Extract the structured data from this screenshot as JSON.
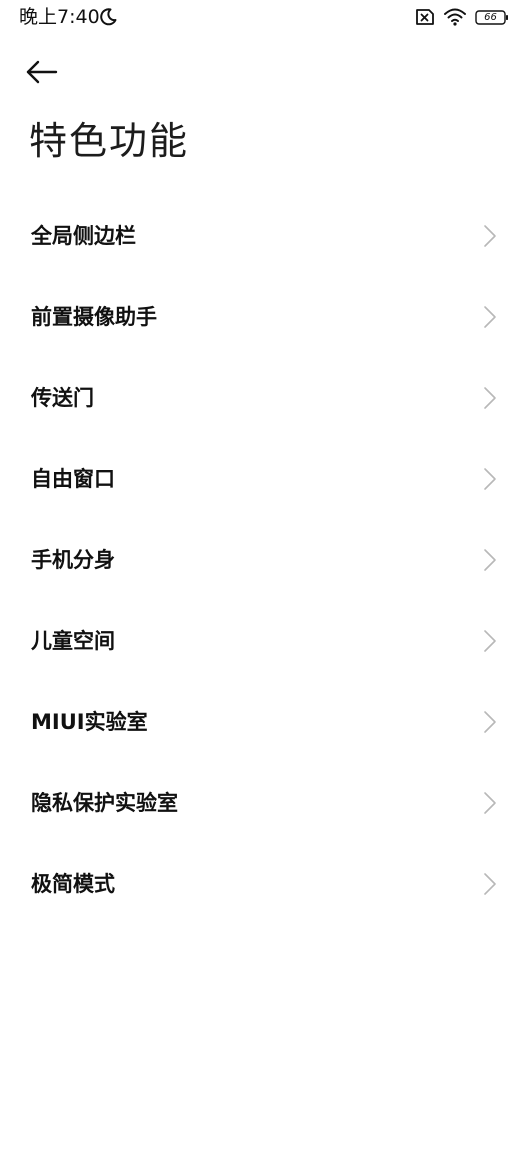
{
  "status_bar": {
    "time": "晚上7:40",
    "battery_level": "66",
    "icons": [
      "moon-icon",
      "sim-off-icon",
      "wifi-icon",
      "battery-icon"
    ]
  },
  "header": {
    "back_icon": "back-arrow-icon",
    "title": "特色功能"
  },
  "list": {
    "items": [
      {
        "label": "全局侧边栏"
      },
      {
        "label": "前置摄像助手"
      },
      {
        "label": "传送门"
      },
      {
        "label": "自由窗口"
      },
      {
        "label": "手机分身"
      },
      {
        "label": "儿童空间"
      },
      {
        "label": "MIUI实验室"
      },
      {
        "label": "隐私保护实验室"
      },
      {
        "label": "极简模式"
      }
    ],
    "chevron_icon": "chevron-right-icon"
  },
  "colors": {
    "background": "#ffffff",
    "text": "#111111",
    "chevron": "#b8b8b8"
  }
}
